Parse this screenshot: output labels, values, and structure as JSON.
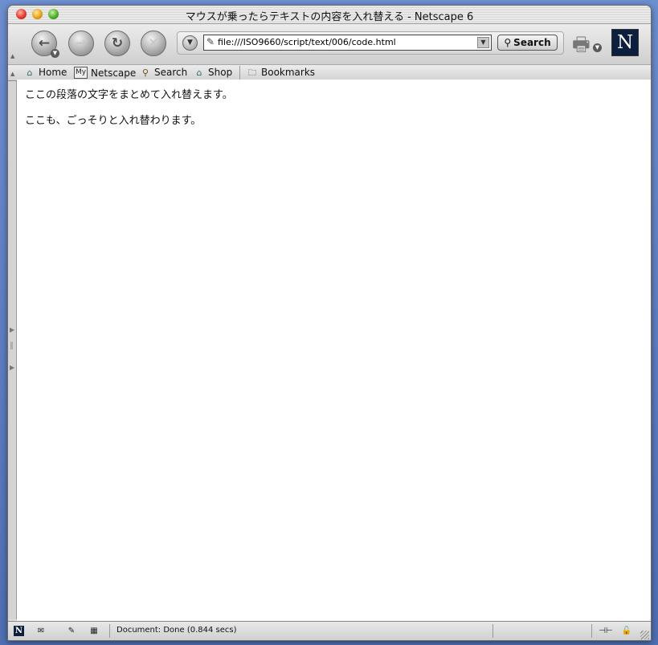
{
  "window": {
    "title": "マウスが乗ったらテキストの内容を入れ替える - Netscape 6"
  },
  "navigation": {
    "back_label": "Back",
    "forward_label": "Forward",
    "reload_label": "Reload",
    "stop_label": "Stop",
    "url": "file:///ISO9660/script/text/006/code.html",
    "search_label": "Search"
  },
  "personal_toolbar": {
    "items": [
      {
        "label": "Home"
      },
      {
        "label": "Netscape"
      },
      {
        "label": "Search"
      },
      {
        "label": "Shop"
      },
      {
        "label": "Bookmarks"
      }
    ]
  },
  "page": {
    "paragraphs": [
      "ここの段落の文字をまとめて入れ替えます。",
      "ここも、ごっそりと入れ替わります。"
    ]
  },
  "status": {
    "text": "Document: Done (0.844 secs)"
  },
  "icons": {
    "back": "back-arrow-icon",
    "forward": "forward-arrow-icon",
    "reload": "reload-icon",
    "stop": "stop-icon",
    "print": "printer-icon",
    "brand": "netscape-logo-icon"
  }
}
